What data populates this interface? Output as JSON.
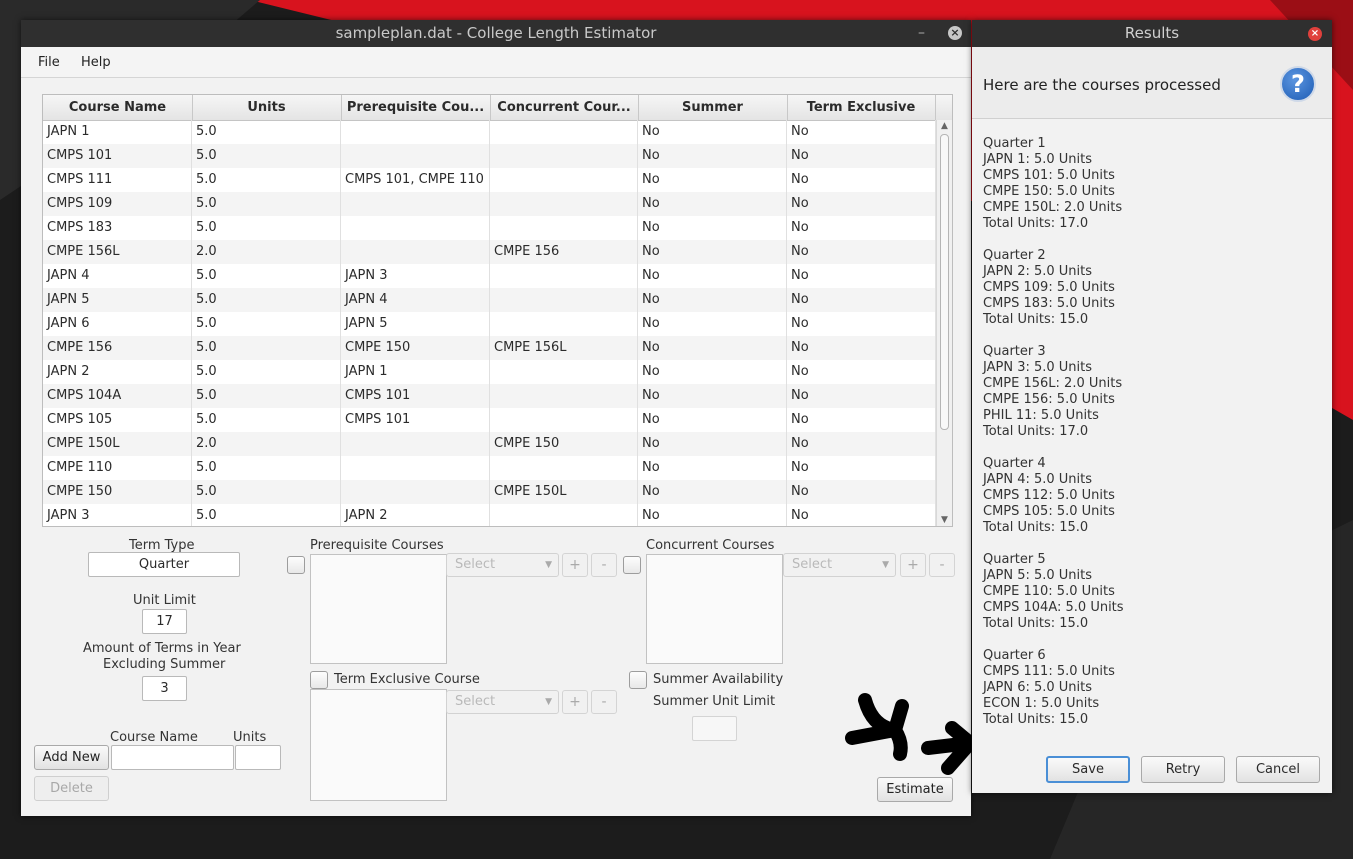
{
  "main_window": {
    "title": "sampleplan.dat - College Length Estimator",
    "minimize": "–",
    "close": "×"
  },
  "menu": [
    "File",
    "Help"
  ],
  "table": {
    "columns": [
      "Course Name",
      "Units",
      "Prerequisite Cou...",
      "Concurrent Cour...",
      "Summer",
      "Term Exclusive"
    ],
    "rows": [
      [
        "JAPN 1",
        "5.0",
        "",
        "",
        "No",
        "No"
      ],
      [
        "CMPS 101",
        "5.0",
        "",
        "",
        "No",
        "No"
      ],
      [
        "CMPS 111",
        "5.0",
        "CMPS 101, CMPE 110",
        "",
        "No",
        "No"
      ],
      [
        "CMPS 109",
        "5.0",
        "",
        "",
        "No",
        "No"
      ],
      [
        "CMPS 183",
        "5.0",
        "",
        "",
        "No",
        "No"
      ],
      [
        "CMPE 156L",
        "2.0",
        "",
        "CMPE 156",
        "No",
        "No"
      ],
      [
        "JAPN 4",
        "5.0",
        "JAPN 3",
        "",
        "No",
        "No"
      ],
      [
        "JAPN 5",
        "5.0",
        "JAPN 4",
        "",
        "No",
        "No"
      ],
      [
        "JAPN 6",
        "5.0",
        "JAPN 5",
        "",
        "No",
        "No"
      ],
      [
        "CMPE 156",
        "5.0",
        "CMPE 150",
        "CMPE 156L",
        "No",
        "No"
      ],
      [
        "JAPN 2",
        "5.0",
        "JAPN 1",
        "",
        "No",
        "No"
      ],
      [
        "CMPS 104A",
        "5.0",
        "CMPS 101",
        "",
        "No",
        "No"
      ],
      [
        "CMPS 105",
        "5.0",
        "CMPS 101",
        "",
        "No",
        "No"
      ],
      [
        "CMPE 150L",
        "2.0",
        "",
        "CMPE 150",
        "No",
        "No"
      ],
      [
        "CMPE 110",
        "5.0",
        "",
        "",
        "No",
        "No"
      ],
      [
        "CMPE 150",
        "5.0",
        "",
        "CMPE 150L",
        "No",
        "No"
      ],
      [
        "JAPN 3",
        "5.0",
        "JAPN 2",
        "",
        "No",
        "No"
      ]
    ]
  },
  "form": {
    "term_type_label": "Term Type",
    "term_type_value": "Quarter",
    "unit_limit_label": "Unit Limit",
    "unit_limit_value": "17",
    "terms_label_1": "Amount of Terms in Year",
    "terms_label_2": "Excluding Summer",
    "terms_value": "3",
    "course_name_label": "Course Name",
    "units_label": "Units",
    "add_new": "Add New",
    "delete": "Delete",
    "prereq_label": "Prerequisite Courses",
    "concurrent_label": "Concurrent Courses",
    "term_exclusive_label": "Term Exclusive Course",
    "summer_avail_label": "Summer Availability",
    "summer_unit_limit_label": "Summer Unit Limit",
    "select_placeholder": "Select",
    "plus": "+",
    "minus": "-",
    "estimate": "Estimate"
  },
  "results": {
    "title": "Results",
    "header": "Here are the courses processed",
    "help_glyph": "?",
    "quarters": [
      {
        "name": "Quarter 1",
        "lines": [
          "JAPN 1: 5.0 Units",
          "CMPS 101: 5.0 Units",
          "CMPE 150: 5.0 Units",
          "CMPE 150L: 2.0 Units"
        ],
        "total": "Total Units: 17.0"
      },
      {
        "name": "Quarter 2",
        "lines": [
          "JAPN 2: 5.0 Units",
          "CMPS 109: 5.0 Units",
          "CMPS 183: 5.0 Units"
        ],
        "total": "Total Units: 15.0"
      },
      {
        "name": "Quarter 3",
        "lines": [
          "JAPN 3: 5.0 Units",
          "CMPE 156L: 2.0 Units",
          "CMPE 156: 5.0 Units",
          "PHIL 11: 5.0 Units"
        ],
        "total": "Total Units: 17.0"
      },
      {
        "name": "Quarter 4",
        "lines": [
          "JAPN 4: 5.0 Units",
          "CMPS 112: 5.0 Units",
          "CMPS 105: 5.0 Units"
        ],
        "total": "Total Units: 15.0"
      },
      {
        "name": "Quarter 5",
        "lines": [
          "JAPN 5: 5.0 Units",
          "CMPE 110: 5.0 Units",
          "CMPS 104A: 5.0 Units"
        ],
        "total": "Total Units: 15.0"
      },
      {
        "name": "Quarter 6",
        "lines": [
          "CMPS 111: 5.0 Units",
          "JAPN 6: 5.0 Units",
          "ECON 1: 5.0 Units"
        ],
        "total": "Total Units: 15.0"
      }
    ],
    "buttons": {
      "save": "Save",
      "retry": "Retry",
      "cancel": "Cancel"
    }
  },
  "colors": {
    "accent": "#4a8fd6",
    "close_red": "#e0403c",
    "wallpaper_red": "#d8131e"
  }
}
